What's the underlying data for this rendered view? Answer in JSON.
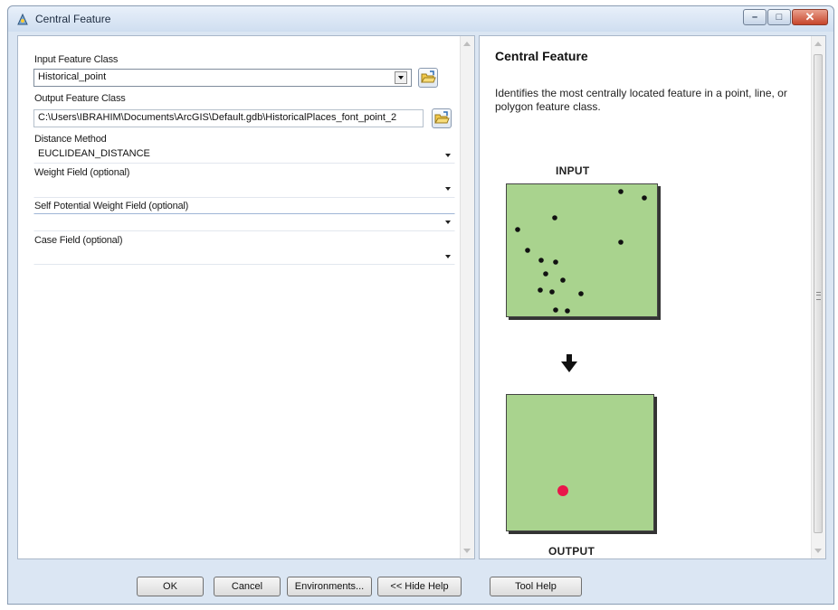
{
  "window": {
    "title": "Central Feature",
    "controls": {
      "minimize": "–",
      "maximize": "□",
      "close": "✕"
    }
  },
  "params": {
    "input_label": "Input Feature Class",
    "input_value": "Historical_point",
    "output_label": "Output Feature Class",
    "output_value": "C:\\Users\\IBRAHIM\\Documents\\ArcGIS\\Default.gdb\\HistoricalPlaces_font_point_2",
    "distance_label": "Distance Method",
    "distance_value": "EUCLIDEAN_DISTANCE",
    "weight_label": "Weight Field (optional)",
    "weight_value": "",
    "self_weight_label": "Self Potential Weight Field (optional)",
    "self_weight_value": "",
    "case_label": "Case Field (optional)",
    "case_value": ""
  },
  "help": {
    "title": "Central Feature",
    "description": "Identifies the most centrally located feature in a point, line, or polygon feature class.",
    "input_caption": "INPUT",
    "output_caption": "OUTPUT",
    "map_fill": "#a9d38e",
    "point_color": "#111111",
    "central_color": "#e8174a"
  },
  "buttons": {
    "ok": "OK",
    "cancel": "Cancel",
    "environments": "Environments...",
    "hide_help": "<< Hide Help",
    "tool_help": "Tool Help"
  }
}
